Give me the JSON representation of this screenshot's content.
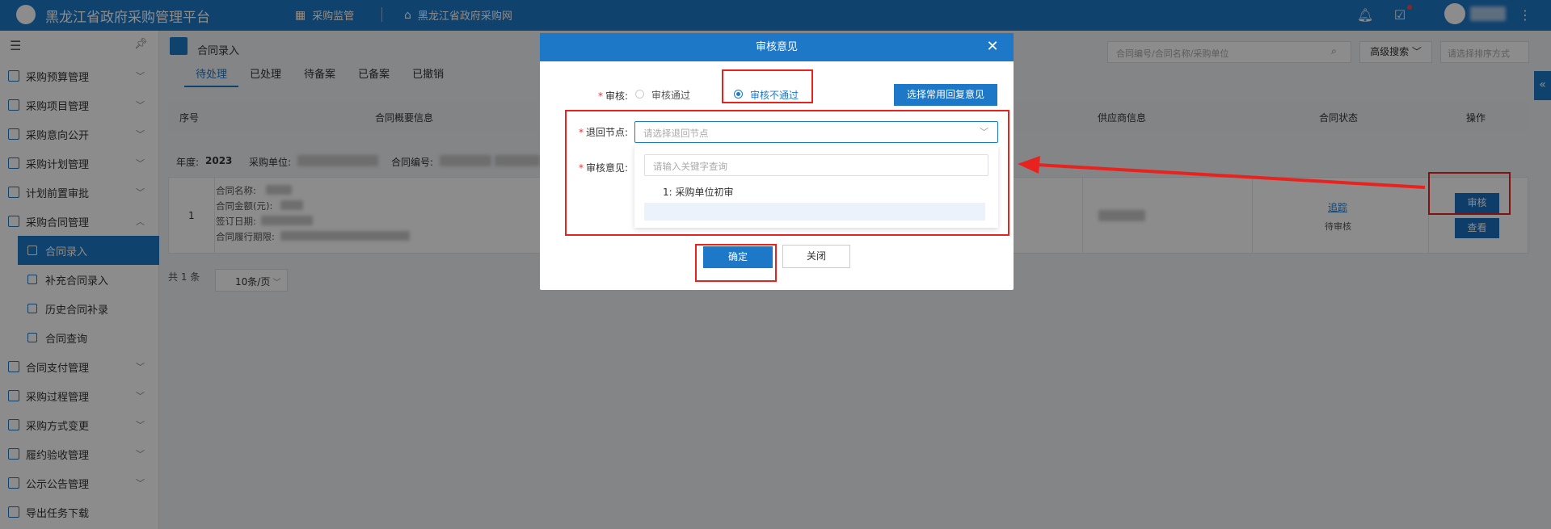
{
  "topbar": {
    "app_title": "黑龙江省政府采购管理平台",
    "nav": [
      {
        "label": "采购监管",
        "icon": "grid-icon"
      },
      {
        "label": "黑龙江省政府采购网",
        "icon": "home-icon"
      }
    ],
    "icons": [
      "bell-icon",
      "task-check-icon",
      "user-avatar-icon",
      "more-vertical-icon"
    ]
  },
  "sidebar": {
    "items": [
      {
        "label": "采购预算管理"
      },
      {
        "label": "采购项目管理"
      },
      {
        "label": "采购意向公开"
      },
      {
        "label": "采购计划管理"
      },
      {
        "label": "计划前置审批"
      },
      {
        "label": "采购合同管理"
      }
    ],
    "subitems": [
      {
        "label": "合同录入"
      },
      {
        "label": "补充合同录入"
      },
      {
        "label": "历史合同补录"
      },
      {
        "label": "合同查询"
      }
    ],
    "items2": [
      {
        "label": "合同支付管理"
      },
      {
        "label": "采购过程管理"
      },
      {
        "label": "采购方式变更"
      },
      {
        "label": "履约验收管理"
      },
      {
        "label": "公示公告管理"
      },
      {
        "label": "导出任务下载"
      }
    ]
  },
  "main": {
    "page_title": "合同录入",
    "tabs": [
      "待处理",
      "已处理",
      "待备案",
      "已备案",
      "已撤销"
    ],
    "search_placeholder": "合同编号/合同名称/采购单位",
    "advanced_search": "高级搜索",
    "sort_placeholder": "请选择排序方式",
    "columns": [
      "序号",
      "合同概要信息",
      "供应商信息",
      "合同状态",
      "操作"
    ],
    "meta": {
      "year_label": "年度:",
      "year": "2023",
      "unit_label": "采购单位:",
      "code_label": "合同编号:"
    },
    "row": {
      "index": "1",
      "fields": [
        "合同名称:",
        "合同金额(元):",
        "签订日期:",
        "合同履行期限:"
      ],
      "status_link": "追踪",
      "status_text": "待审核",
      "audit_button": "审核",
      "view_button": "查看"
    },
    "total": "共 1 条",
    "page_size": "10条/页"
  },
  "modal": {
    "title": "审核意见",
    "audit_label": "审核:",
    "radio_pass": "审核通过",
    "radio_fail": "审核不通过",
    "reply_button": "选择常用回复意见",
    "return_node_label": "退回节点:",
    "return_node_placeholder": "请选择退回节点",
    "opinion_label": "审核意见:",
    "dropdown_search_placeholder": "请输入关键字查询",
    "dropdown_option": "1:  采购单位初审",
    "ok_button": "确定",
    "close_button": "关闭"
  },
  "colors": {
    "primary": "#1e78c8",
    "highlight": "#e8231f"
  }
}
